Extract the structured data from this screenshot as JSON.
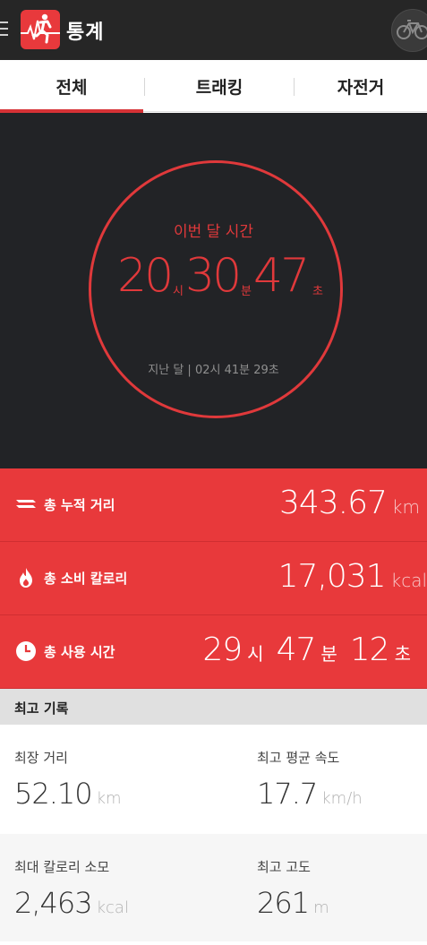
{
  "header": {
    "title": "통계",
    "menu_icon": "hamburger-menu-icon",
    "logo_icon": "runner-logo-icon",
    "bike_icon": "bicycle-icon"
  },
  "tabs": [
    {
      "label": "전체",
      "active": true
    },
    {
      "label": "트래킹",
      "active": false
    },
    {
      "label": "자전거",
      "active": false
    }
  ],
  "month_time": {
    "label": "이번 달 시간",
    "hours": "20",
    "hours_unit": "시",
    "minutes": "30",
    "minutes_unit": "분",
    "seconds": "47",
    "seconds_unit": "초",
    "last_month": "지난 달 | 02시 41분 29초"
  },
  "stats": [
    {
      "icon": "distance-road-icon",
      "label": "총 누적 거리",
      "value": "343.67",
      "unit": "km"
    },
    {
      "icon": "flame-icon",
      "label": "총 소비 칼로리",
      "value": "17,031",
      "unit": "kcal"
    },
    {
      "icon": "clock-icon",
      "label": "총 사용 시간",
      "value_h": "29",
      "unit_h": "시",
      "value_m": "47",
      "unit_m": "분",
      "value_s": "12",
      "unit_s": "초"
    }
  ],
  "records": {
    "title": "최고 기록",
    "items": [
      {
        "label": "최장 거리",
        "value": "52.10",
        "unit": "km"
      },
      {
        "label": "최고 평균 속도",
        "value": "17.7",
        "unit": "km/h"
      },
      {
        "label": "최대 칼로리 소모",
        "value": "2,463",
        "unit": "kcal"
      },
      {
        "label": "최고 고도",
        "value": "261",
        "unit": "m"
      }
    ]
  },
  "colors": {
    "accent_red": "#e8393b",
    "dark_bg": "#222326",
    "header_bg": "#262626"
  }
}
